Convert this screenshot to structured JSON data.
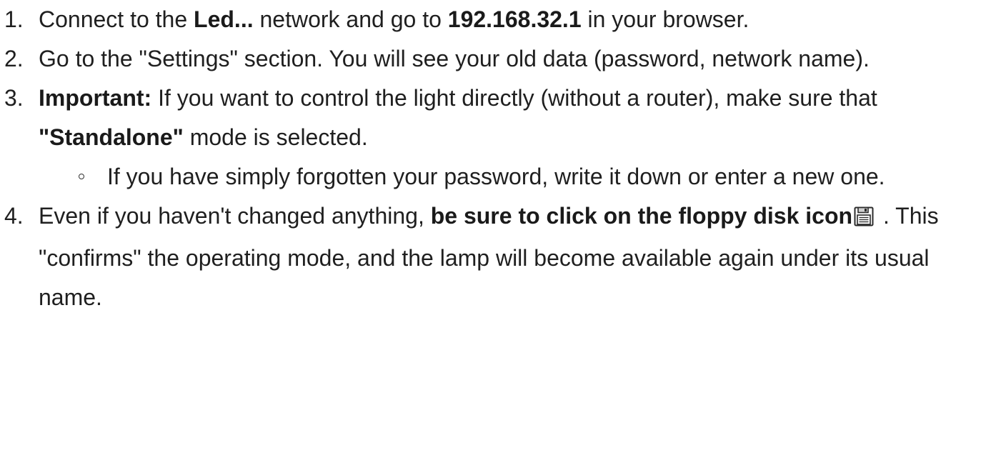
{
  "steps": [
    {
      "number": "1.",
      "parts": {
        "t1": "Connect to the ",
        "b1": "Led...",
        "t2": " network and go to ",
        "b2": "192.168.32.1",
        "t3": " in your browser."
      }
    },
    {
      "number": "2.",
      "parts": {
        "t1": "Go to the \"Settings\" section. You will see your old data (password, network name)."
      }
    },
    {
      "number": "3.",
      "parts": {
        "b1": "Important:",
        "t1": " If you want to control the light directly (without a router), make sure that ",
        "b2": "\"Standalone\"",
        "t2": " mode is selected."
      },
      "subitems": [
        "If you have simply forgotten your password, write it down or enter a new one."
      ]
    },
    {
      "number": "4.",
      "parts": {
        "t1": "Even if you haven't changed anything, ",
        "b1": "be sure to click on the floppy disk icon",
        "icon": "floppy-disk-icon",
        "t2": " . This \"confirms\" the operating mode, and the lamp will become available again under its usual name."
      }
    }
  ],
  "colors": {
    "text": "#1f1f1f",
    "background": "#ffffff"
  }
}
